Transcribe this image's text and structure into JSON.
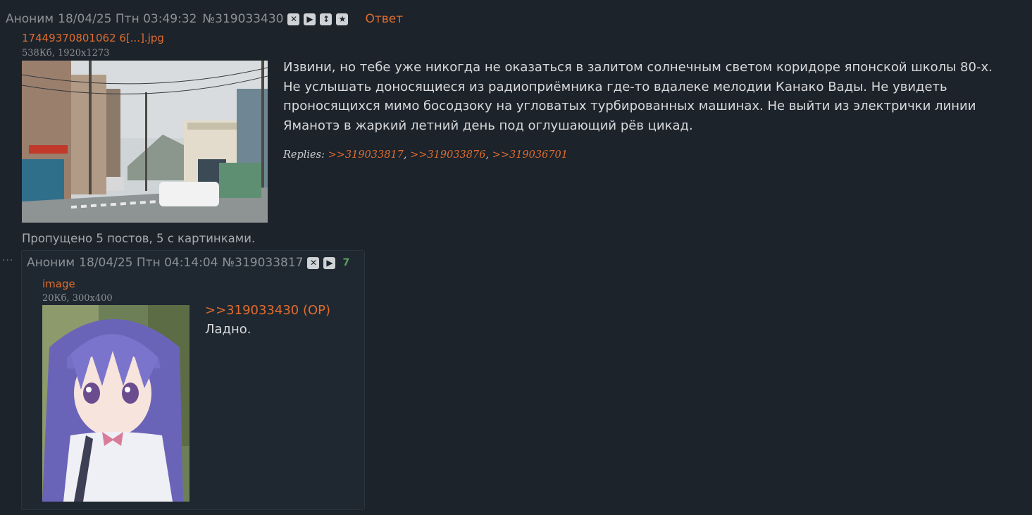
{
  "op": {
    "author": "Аноним",
    "date": "18/04/25 Птн 03:49:32",
    "number": "№319033430",
    "reply_label": "Ответ",
    "icons": [
      "close-icon",
      "play-icon",
      "expand-icon",
      "star-icon"
    ],
    "file": {
      "name": "17449370801062 6[...].jpg",
      "info": "538Кб, 1920x1273"
    },
    "text": "Извини, но тебе уже никогда не оказаться в залитом солнечным светом коридоре японской школы 80-х. Не услышать доносящиеся из радиоприёмника где-то вдалеке мелодии Канако Вады. Не увидеть проносящихся мимо босодзоку на угловатых турбированных машинах. Не выйти из электрички линии Яманотэ в жаркий летний день под оглушающий рёв цикад.",
    "replies_label": "Replies:",
    "replies": [
      ">>319033817",
      ">>319033876",
      ">>319036701"
    ]
  },
  "omitted": "Пропущено 5 постов, 5 с картинками.",
  "dots": "...",
  "reply": {
    "author": "Аноним",
    "date": "18/04/25 Птн 04:14:04",
    "number": "№319033817",
    "icons": [
      "close-icon",
      "play-icon"
    ],
    "count": "7",
    "file": {
      "name": "image",
      "info": "20Кб, 300x400"
    },
    "quote": ">>319033430 (OP)",
    "text": "Ладно."
  }
}
